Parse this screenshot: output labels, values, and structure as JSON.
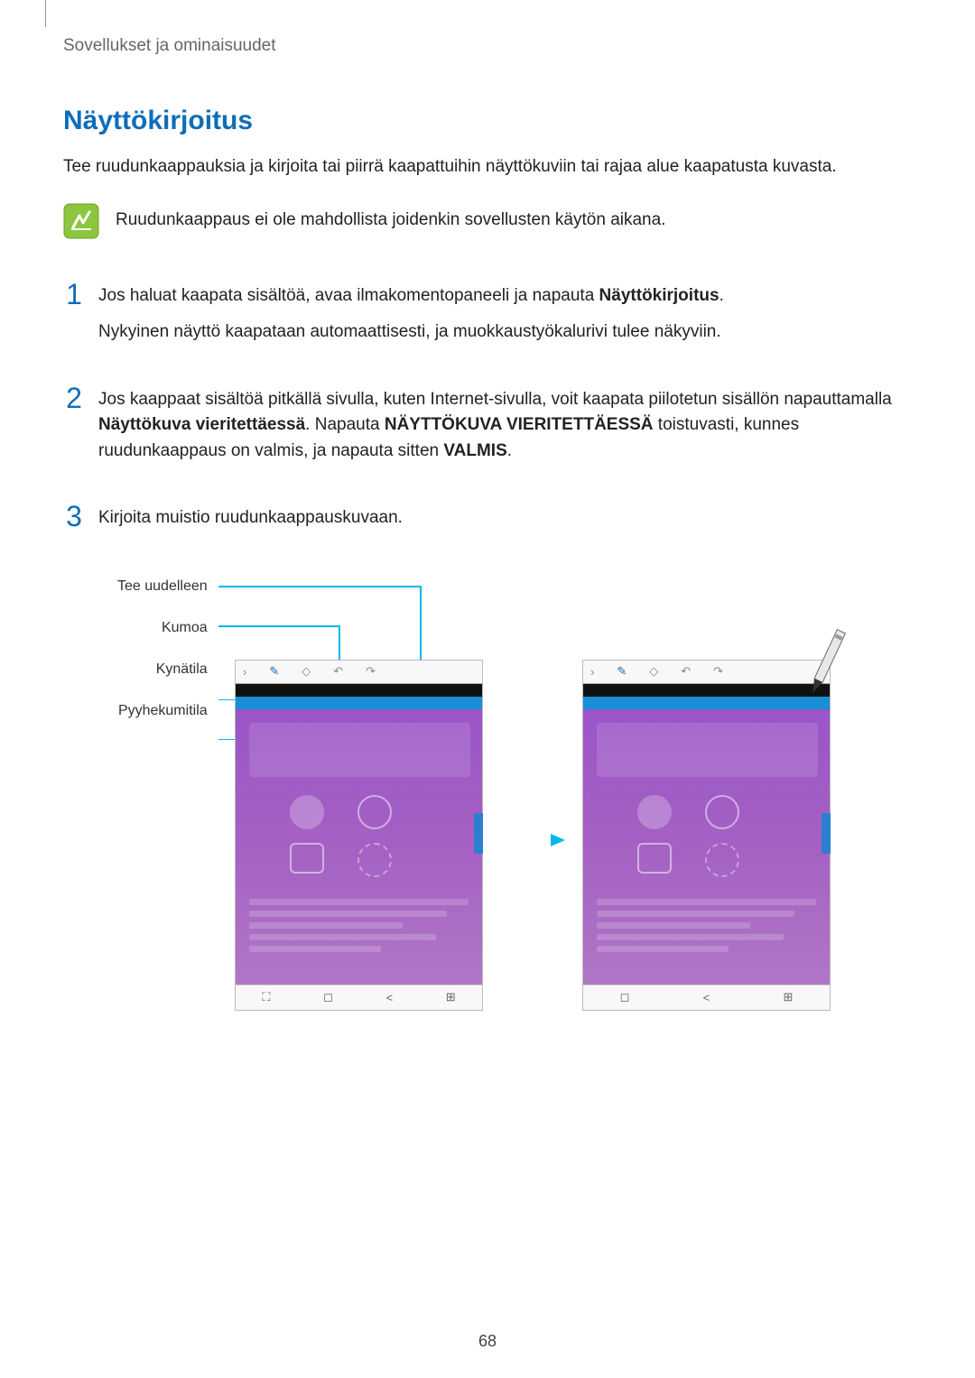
{
  "header": "Sovellukset ja ominaisuudet",
  "title": "Näyttökirjoitus",
  "intro": "Tee ruudunkaappauksia ja kirjoita tai piirrä kaapattuihin näyttökuviin tai rajaa alue kaapatusta kuvasta.",
  "note": "Ruudunkaappaus ei ole mahdollista joidenkin sovellusten käytön aikana.",
  "step1_a": "Jos haluat kaapata sisältöä, avaa ilmakomentopaneeli ja napauta ",
  "step1_bold": "Näyttökirjoitus",
  "step1_b": ".",
  "step1_p2": "Nykyinen näyttö kaapataan automaattisesti, ja muokkaustyökalurivi tulee näkyviin.",
  "step2_a": "Jos kaappaat sisältöä pitkällä sivulla, kuten Internet-sivulla, voit kaapata piilotetun sisällön napauttamalla ",
  "step2_bold1": "Näyttökuva vieritettäessä",
  "step2_mid": ". Napauta ",
  "step2_bold2": "NÄYTTÖKUVA VIERITETTÄESSÄ",
  "step2_b": " toistuvasti, kunnes ruudunkaappaus on valmis, ja napauta sitten ",
  "step2_bold3": "VALMIS",
  "step2_c": ".",
  "step3": "Kirjoita muistio ruudunkaappauskuvaan.",
  "callouts": {
    "redo": "Tee uudelleen",
    "undo": "Kumoa",
    "pen": "Kynätila",
    "eraser": "Pyyhekumitila"
  },
  "page_number": "68"
}
